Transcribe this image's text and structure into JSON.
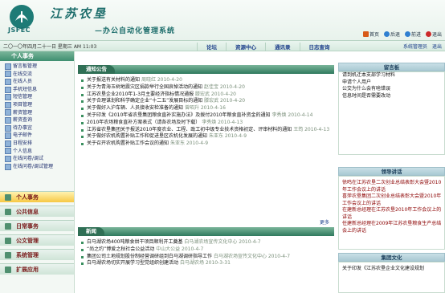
{
  "header": {
    "logo_abbr": "JSFEC",
    "brand": "江苏农垦",
    "subtitle": "—办公自动化管理系统",
    "toplinks": [
      {
        "label": "首页",
        "icon": "home-icon",
        "color": "#d85a1a"
      },
      {
        "label": "后退",
        "icon": "back-icon",
        "color": "#2f7fd0"
      },
      {
        "label": "前进",
        "icon": "forward-icon",
        "color": "#2f7fd0"
      },
      {
        "label": "退出",
        "icon": "exit-icon",
        "color": "#cc2a2a"
      }
    ]
  },
  "navbar": {
    "date": "二〇一〇年四月二十一日 星期三 AM 11:03",
    "items": [
      "论坛",
      "资源中心",
      "通讯录",
      "日志查询"
    ],
    "settings": "系统管理员",
    "exit": "退出"
  },
  "sidebar": {
    "header": "个人事务",
    "items": [
      "留言板管理",
      "在线交流",
      "在线人员",
      "手机短信息",
      "短信管理",
      "项目管理",
      "薪资管理",
      "薪资查询",
      "待办事宜",
      "电子邮件",
      "日程安排",
      "个人信息",
      "在线问卷/调试",
      "在线问卷/调试管理"
    ],
    "tabs": [
      {
        "label": "个人事务",
        "active": true
      },
      {
        "label": "公共信息",
        "active": false
      },
      {
        "label": "日常事务",
        "active": false
      },
      {
        "label": "公文管理",
        "active": false
      },
      {
        "label": "系统管理",
        "active": false
      },
      {
        "label": "扩展应用",
        "active": false
      }
    ]
  },
  "notices": {
    "tab": "通知公告",
    "more": "更多",
    "items": [
      {
        "title": "关于报送有关材料的通知",
        "meta": "周晓红  2010-4-20"
      },
      {
        "title": "关于为青海玉树地震灾区捐款举行全国哀悼活动的通知",
        "meta": "赵佳宝  2010-4-20"
      },
      {
        "title": "江苏农垦企业2010年1-3月主要经济指标情况通报",
        "meta": "滕宏武  2010-4-20"
      },
      {
        "title": "关于合理谋划和科学确定企业“十二五”发展目标的通知",
        "meta": "滕宏武  2010-4-20"
      },
      {
        "title": "关于做好入沪车辆、人员接收安检准备的通知",
        "meta": "曾昭升  2010-4-16"
      },
      {
        "title": "关于印发《2010年省农垦集团粮食直补实施办法》及拨付2010年粮食直补资金的通知",
        "meta": "李秀焕  2010-4-14"
      },
      {
        "title": "2010年农场粮食直补方案表式（请各农场及时下载）",
        "meta": "李秀焕  2010-4-13"
      },
      {
        "title": "江苏省农垦集团关于报送2010年度农业、工程、政工初中级专业技术资格初定、评审材料的通知",
        "meta": "王筠  2010-4-13"
      },
      {
        "title": "关于做好农机购置补贴工作和促进垦区农机化发展的通知",
        "meta": "朱亚东  2010-4-9"
      },
      {
        "title": "关于召开农机购置补贴工作会议的通知",
        "meta": "朱亚东  2010-4-9"
      }
    ]
  },
  "news": {
    "tab": "新闻",
    "items": [
      {
        "title": "白马湖农场400吨粮食烘干项目顺利开工奠基",
        "meta": "白马湖农场宣传文化中心  2010-4-7"
      },
      {
        "title": "“尚之约”博爱之秋社会公益活动",
        "meta": "中山大公益  2010-4-7"
      },
      {
        "title": "集团公司土地规划股份制经营调研组到白马湖调研指导工作",
        "meta": "白马湖农场宣传文化中心  2010-4-7"
      },
      {
        "title": "白马湖农场切实开展学习型党组织创建活动",
        "meta": "白马湖农场  2010-3-31"
      }
    ]
  },
  "right": {
    "board_title": "留言板",
    "board_items": [
      "请到机迁本支部学习材料",
      "申请个人用户",
      "公交为什么会有啥错误",
      "信息时间是否需要改动"
    ],
    "leader_title": "领导讲话",
    "leader_items": [
      "徐鸣在江苏农垦二次创业总结表彰大会暨2010年工作会议上的讲话",
      "喜萍农垦集团二次创业总结表彰大会暨2010年工作会议上的讲话",
      "在建新总经理在江苏农垦2010年工作会议上的讲话",
      "任建新总经理在2009年江苏农垦粮食生产总结会上的讲话"
    ],
    "culture_title": "集团文化",
    "culture_items": [
      "关于印发《江苏农垦企业文化建设规划"
    ]
  }
}
